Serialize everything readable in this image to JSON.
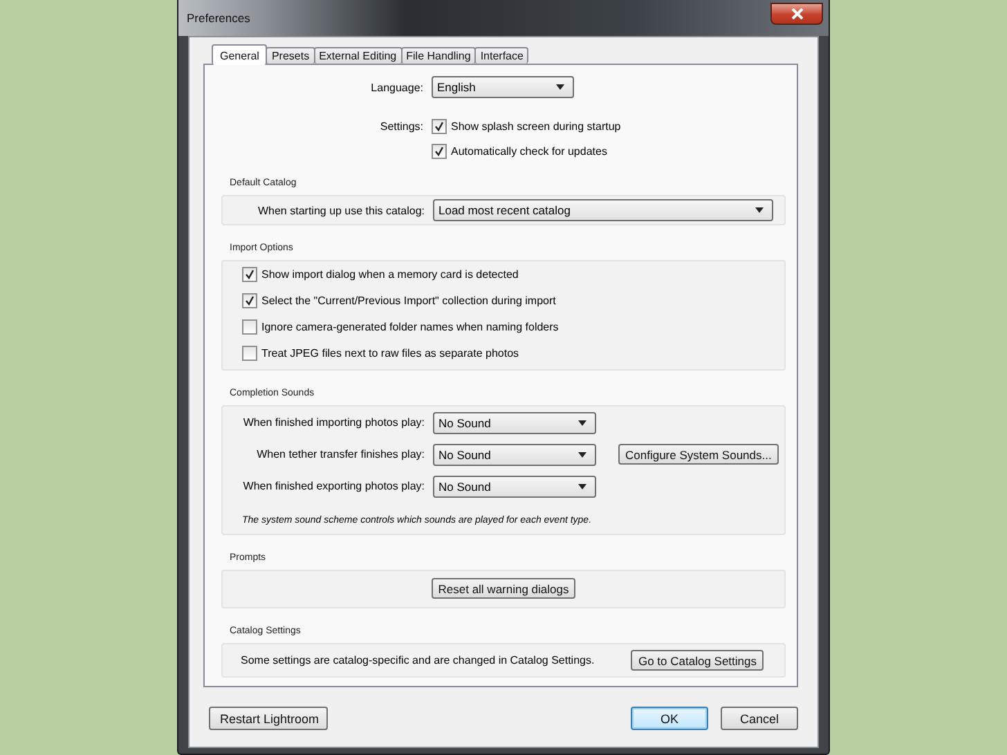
{
  "window": {
    "title": "Preferences"
  },
  "tabs": [
    {
      "label": "General",
      "selected": true
    },
    {
      "label": "Presets",
      "selected": false
    },
    {
      "label": "External Editing",
      "selected": false
    },
    {
      "label": "File Handling",
      "selected": false
    },
    {
      "label": "Interface",
      "selected": false
    }
  ],
  "language": {
    "label": "Language:",
    "value": "English"
  },
  "settings": {
    "label": "Settings:",
    "options": [
      {
        "label": "Show splash screen during startup",
        "checked": true
      },
      {
        "label": "Automatically check for updates",
        "checked": true
      }
    ]
  },
  "sections": [
    {
      "kind": "select",
      "title": "Default Catalog",
      "label": "When starting up use this catalog:",
      "value": "Load most recent catalog"
    },
    {
      "kind": "checks",
      "title": "Import Options",
      "options": [
        {
          "label": "Show import dialog when a memory card is detected",
          "checked": true
        },
        {
          "label": "Select the \"Current/Previous Import\" collection during import",
          "checked": true
        },
        {
          "label": "Ignore camera-generated folder names when naming folders",
          "checked": false
        },
        {
          "label": "Treat JPEG files next to raw files as separate photos",
          "checked": false
        }
      ]
    },
    {
      "kind": "sounds",
      "title": "Completion Sounds",
      "rows": [
        {
          "label": "When finished importing photos play:",
          "value": "No Sound"
        },
        {
          "label": "When tether transfer finishes play:",
          "value": "No Sound"
        },
        {
          "label": "When finished exporting photos play:",
          "value": "No Sound"
        }
      ],
      "button": "Configure System Sounds...",
      "note": "The system sound scheme controls which sounds are played for each event type."
    },
    {
      "kind": "button",
      "title": "Prompts",
      "button": "Reset all warning dialogs"
    },
    {
      "kind": "text_button",
      "title": "Catalog Settings",
      "text": "Some settings are catalog-specific and are changed in Catalog Settings.",
      "button": "Go to Catalog Settings"
    }
  ],
  "footer": {
    "left_button": "Restart Lightroom",
    "buttons": [
      {
        "label": "OK",
        "default": true
      },
      {
        "label": "Cancel",
        "default": false
      }
    ]
  }
}
